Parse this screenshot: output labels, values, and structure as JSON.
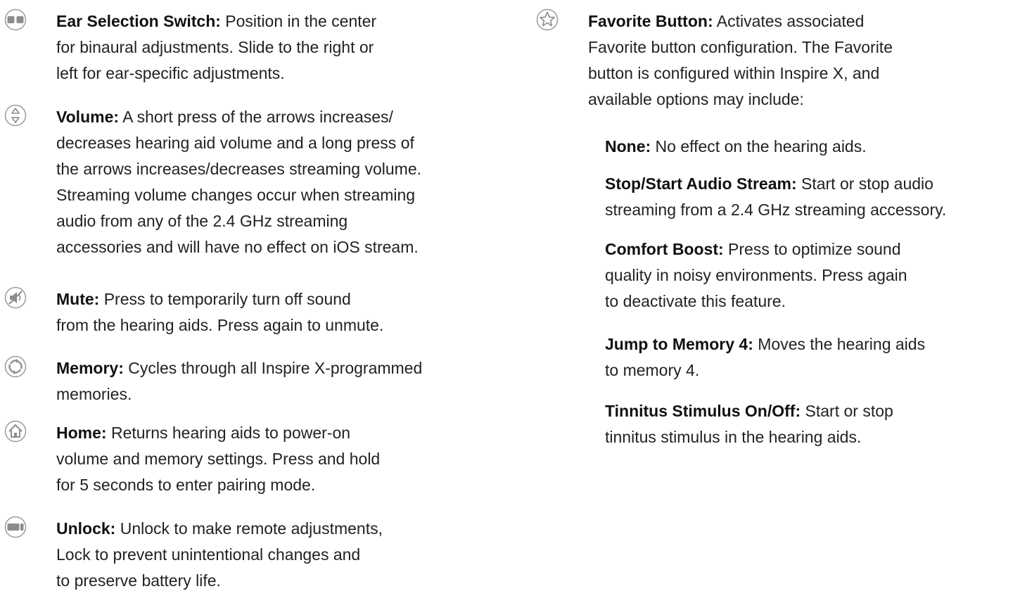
{
  "left_items": [
    {
      "icon": "ear-selection-switch-icon",
      "term": "Ear Selection Switch:",
      "lines": [
        " Position in the center",
        "for binaural adjustments. Slide to the right or",
        "left for ear-specific adjustments."
      ]
    },
    {
      "icon": "volume-arrows-icon",
      "term": "Volume:",
      "lines": [
        " A short press of the arrows increases/",
        "decreases hearing aid volume and a long press of",
        "the arrows increases/decreases streaming volume.",
        "Streaming volume changes occur when streaming",
        "audio from any of the 2.4 GHz streaming",
        "accessories and will have no effect on iOS stream."
      ]
    },
    {
      "icon": "mute-speaker-icon",
      "term": "Mute:",
      "lines": [
        " Press to temporarily turn off sound",
        "from the hearing aids. Press again to unmute."
      ]
    },
    {
      "icon": "memory-cycle-icon",
      "term": "Memory:",
      "lines": [
        " Cycles through all Inspire X-programmed",
        "memories."
      ]
    },
    {
      "icon": "home-icon",
      "term": "Home:",
      "lines": [
        " Returns hearing aids to power-on",
        "volume and memory settings. Press and hold",
        "for 5 seconds to enter pairing mode."
      ]
    },
    {
      "icon": "unlock-switch-icon",
      "term": "Unlock:",
      "lines": [
        " Unlock to make remote adjustments,",
        "Lock to prevent unintentional changes and",
        "to preserve battery life."
      ]
    }
  ],
  "favorite": {
    "icon": "star-icon",
    "term": "Favorite Button:",
    "lines": [
      " Activates associated",
      "Favorite button configuration. The Favorite",
      "button is configured within Inspire X, and",
      "available options may include:"
    ]
  },
  "favorite_options": [
    {
      "term": "None:",
      "lines": [
        " No effect on the hearing aids."
      ]
    },
    {
      "term": "Stop/Start Audio Stream:",
      "lines": [
        " Start or stop audio",
        "streaming from a 2.4 GHz streaming accessory."
      ]
    },
    {
      "term": "Comfort Boost:",
      "lines": [
        " Press to optimize sound",
        "quality in noisy environments. Press again",
        "to deactivate this feature."
      ]
    },
    {
      "term": "Jump to Memory 4:",
      "lines": [
        " Moves the hearing aids",
        "to memory 4."
      ]
    },
    {
      "term": "Tinnitus Stimulus On/Off:",
      "lines": [
        " Start or stop",
        "tinnitus stimulus in the hearing aids."
      ]
    }
  ]
}
